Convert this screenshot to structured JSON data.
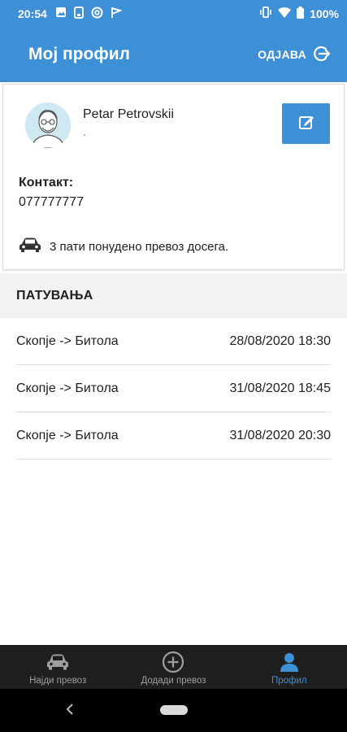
{
  "status_bar": {
    "time": "20:54",
    "battery": "100%",
    "icons": [
      "image-icon",
      "phone-icon",
      "at-icon",
      "flag-icon",
      "vibrate-icon",
      "wifi-icon",
      "battery-icon"
    ]
  },
  "app_bar": {
    "title": "Мој профил",
    "logout_label": "ОДЈАВА",
    "background": "#3d8fd6"
  },
  "profile": {
    "name": "Petar Petrovskii",
    "subtitle": ".",
    "contact_label": "Контакт:",
    "contact_value": "077777777",
    "offers_text": "3 пати понудено превоз досега."
  },
  "trips": {
    "header": "ПАТУВАЊА",
    "items": [
      {
        "route": "Скопје -> Битола",
        "datetime": "28/08/2020 18:30"
      },
      {
        "route": "Скопје -> Битола",
        "datetime": "31/08/2020 18:45"
      },
      {
        "route": "Скопје -> Битола",
        "datetime": "31/08/2020 20:30"
      }
    ]
  },
  "bottom_nav": {
    "items": [
      {
        "label": "Најди превоз",
        "icon": "car-icon",
        "active": false
      },
      {
        "label": "Додади превоз",
        "icon": "add-circle-icon",
        "active": false
      },
      {
        "label": "Профил",
        "icon": "person-icon",
        "active": true
      }
    ],
    "active_color": "#3d8fd6"
  }
}
